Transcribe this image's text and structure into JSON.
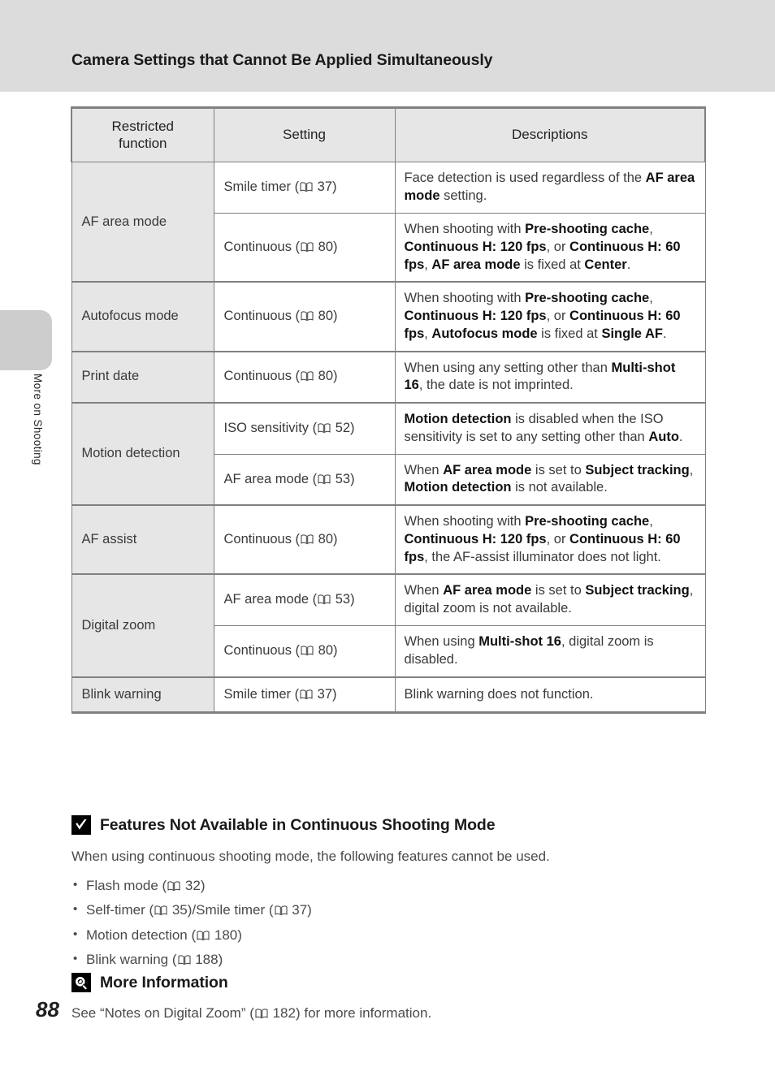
{
  "header": {
    "title": "Camera Settings that Cannot Be Applied Simultaneously"
  },
  "side_tab": {
    "label": "More on Shooting"
  },
  "page": {
    "number": "88"
  },
  "table": {
    "columns": [
      "Restricted function",
      "Setting",
      "Descriptions"
    ],
    "col_header_1_line1": "Restricted",
    "col_header_1_line2": "function",
    "rows": [
      {
        "function": "AF area mode",
        "entries": [
          {
            "setting": "Smile timer (",
            "setting_page": "37)",
            "desc_parts": [
              {
                "t": "Face detection is used regardless of the ",
                "b": false
              },
              {
                "t": "AF area mode",
                "b": true
              },
              {
                "t": " setting.",
                "b": false
              }
            ]
          },
          {
            "setting": "Continuous (",
            "setting_page": "80)",
            "desc_parts": [
              {
                "t": "When shooting with ",
                "b": false
              },
              {
                "t": "Pre-shooting cache",
                "b": true
              },
              {
                "t": ", ",
                "b": false
              },
              {
                "t": "Continuous H: 120 fps",
                "b": true
              },
              {
                "t": ", or ",
                "b": false
              },
              {
                "t": "Continuous H: 60 fps",
                "b": true
              },
              {
                "t": ", ",
                "b": false
              },
              {
                "t": "AF area mode",
                "b": true
              },
              {
                "t": " is fixed at ",
                "b": false
              },
              {
                "t": "Center",
                "b": true
              },
              {
                "t": ".",
                "b": false
              }
            ]
          }
        ]
      },
      {
        "function": "Autofocus mode",
        "entries": [
          {
            "setting": "Continuous (",
            "setting_page": "80)",
            "desc_parts": [
              {
                "t": "When shooting with ",
                "b": false
              },
              {
                "t": "Pre-shooting cache",
                "b": true
              },
              {
                "t": ", ",
                "b": false
              },
              {
                "t": "Continuous H: 120 fps",
                "b": true
              },
              {
                "t": ", or ",
                "b": false
              },
              {
                "t": "Continuous H: 60 fps",
                "b": true
              },
              {
                "t": ", ",
                "b": false
              },
              {
                "t": "Autofocus mode",
                "b": true
              },
              {
                "t": " is fixed at ",
                "b": false
              },
              {
                "t": "Single AF",
                "b": true
              },
              {
                "t": ".",
                "b": false
              }
            ]
          }
        ]
      },
      {
        "function": "Print date",
        "entries": [
          {
            "setting": "Continuous (",
            "setting_page": "80)",
            "desc_parts": [
              {
                "t": "When using any setting other than ",
                "b": false
              },
              {
                "t": "Multi-shot 16",
                "b": true
              },
              {
                "t": ", the date is not imprinted.",
                "b": false
              }
            ]
          }
        ]
      },
      {
        "function": "Motion detection",
        "entries": [
          {
            "setting": "ISO sensitivity (",
            "setting_page": "52)",
            "desc_parts": [
              {
                "t": "Motion detection",
                "b": true
              },
              {
                "t": " is disabled when the ISO sensitivity is set to any setting other than ",
                "b": false
              },
              {
                "t": "Auto",
                "b": true
              },
              {
                "t": ".",
                "b": false
              }
            ]
          },
          {
            "setting": "AF area mode (",
            "setting_page": "53)",
            "desc_parts": [
              {
                "t": "When ",
                "b": false
              },
              {
                "t": "AF area mode",
                "b": true
              },
              {
                "t": " is set to ",
                "b": false
              },
              {
                "t": "Subject tracking",
                "b": true
              },
              {
                "t": ", ",
                "b": false
              },
              {
                "t": "Motion detection",
                "b": true
              },
              {
                "t": " is not available.",
                "b": false
              }
            ]
          }
        ]
      },
      {
        "function": "AF assist",
        "entries": [
          {
            "setting": "Continuous (",
            "setting_page": "80)",
            "desc_parts": [
              {
                "t": "When shooting with ",
                "b": false
              },
              {
                "t": "Pre-shooting cache",
                "b": true
              },
              {
                "t": ", ",
                "b": false
              },
              {
                "t": "Continuous H: 120 fps",
                "b": true
              },
              {
                "t": ", or ",
                "b": false
              },
              {
                "t": "Continuous H: 60 fps",
                "b": true
              },
              {
                "t": ", the AF-assist illuminator does not light.",
                "b": false
              }
            ]
          }
        ]
      },
      {
        "function": "Digital zoom",
        "entries": [
          {
            "setting": "AF area mode (",
            "setting_page": "53)",
            "desc_parts": [
              {
                "t": "When ",
                "b": false
              },
              {
                "t": "AF area mode",
                "b": true
              },
              {
                "t": " is set to ",
                "b": false
              },
              {
                "t": "Subject tracking",
                "b": true
              },
              {
                "t": ", digital zoom is not available.",
                "b": false
              }
            ]
          },
          {
            "setting": "Continuous (",
            "setting_page": "80)",
            "desc_parts": [
              {
                "t": "When using ",
                "b": false
              },
              {
                "t": "Multi-shot 16",
                "b": true
              },
              {
                "t": ", digital zoom is disabled.",
                "b": false
              }
            ]
          }
        ]
      },
      {
        "function": "Blink warning",
        "entries": [
          {
            "setting": "Smile timer (",
            "setting_page": "37)",
            "desc_parts": [
              {
                "t": "Blink warning does not function.",
                "b": false
              }
            ]
          }
        ]
      }
    ]
  },
  "notes": {
    "features": {
      "icon": "checkmark-icon",
      "heading": "Features Not Available in Continuous Shooting Mode",
      "intro": "When using continuous shooting mode, the following features cannot be used.",
      "items": [
        {
          "pre": "Flash mode (",
          "page": "32)",
          "post": ""
        },
        {
          "pre": "Self-timer (",
          "page": "35)/Smile timer (",
          "page2": "37)",
          "post": ""
        },
        {
          "pre": "Motion detection (",
          "page": "180)",
          "post": ""
        },
        {
          "pre": "Blink warning (",
          "page": "188)",
          "post": ""
        }
      ]
    },
    "more_info": {
      "icon": "lightbulb-icon",
      "heading": "More Information",
      "text_pre": "See “Notes on Digital Zoom” (",
      "text_page": "182)",
      "text_post": " for more information."
    }
  },
  "colors": {
    "header_band": "#dcdcdc",
    "table_header_fill": "#e6e6e6",
    "table_border": "#808080",
    "tab_fill": "#cdcdcd",
    "text": "#4a4a4a"
  }
}
